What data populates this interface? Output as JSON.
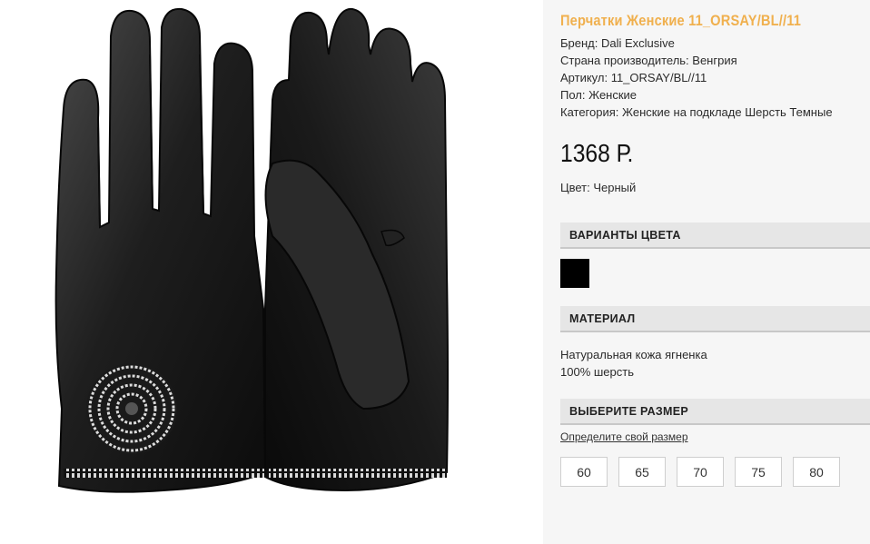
{
  "product": {
    "title": "Перчатки Женские 11_ORSAY/BL//11",
    "specs": [
      {
        "label": "Бренд: Dali Exclusive"
      },
      {
        "label": "Страна производитель: Венгрия"
      },
      {
        "label": "Артикул: 11_ORSAY/BL//11"
      },
      {
        "label": "Пол: Женские"
      },
      {
        "label": "Категория: Женские на подкладе Шерсть Темные"
      }
    ],
    "price": "1368 Р.",
    "color_line": "Цвет: Черный"
  },
  "sections": {
    "color_variants": "ВАРИАНТЫ ЦВЕТА",
    "material": "МАТЕРИАЛ",
    "choose_size": "ВЫБЕРИТЕ РАЗМЕР"
  },
  "color_swatches": [
    {
      "name": "black",
      "hex": "#000000"
    }
  ],
  "material_lines": [
    "Натуральная кожа ягненка",
    "100% шерсть"
  ],
  "size_link": "Определите свой размер",
  "sizes": [
    "60",
    "65",
    "70",
    "75",
    "80"
  ],
  "accent_color": "#f0b04e",
  "image_alt_icon": "glove-image"
}
